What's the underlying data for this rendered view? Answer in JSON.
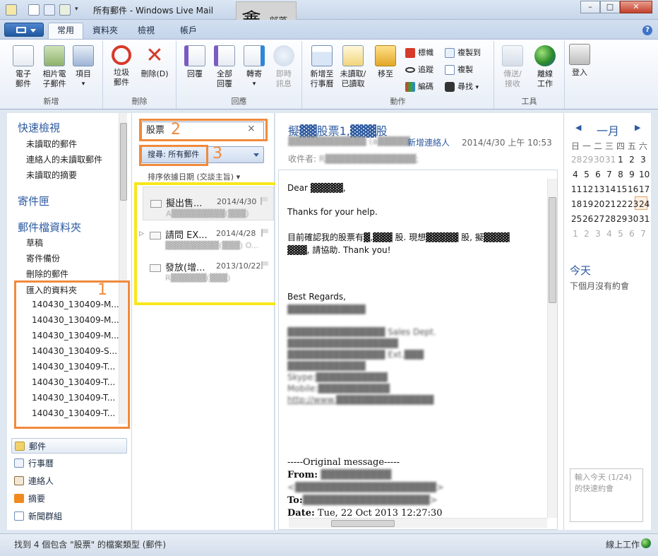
{
  "window": {
    "title": "所有郵件 - Windows Live Mail",
    "logo_main": "鑫",
    "logo_sub": "部落",
    "controls": [
      "–",
      "□",
      "✕"
    ]
  },
  "tabs": [
    "常用",
    "資料夾",
    "檢視",
    "帳戶"
  ],
  "ribbon": {
    "groups": {
      "new": "新增",
      "delete": "刪除",
      "respond": "回應",
      "actions": "動作",
      "tools": "工具"
    },
    "buttons": {
      "email_msg": "電子\n郵件",
      "photo_email": "相片電\n子郵件",
      "items": "項目",
      "junk": "垃圾\n郵件",
      "delete": "刪除(D)",
      "reply": "回覆",
      "reply_all": "全部\n回覆",
      "forward": "轉寄",
      "instant_msg": "即時\n訊息",
      "add_to_calendar": "新增至\n行事曆",
      "unread_read": "未讀取/\n已讀取",
      "move_to": "移至",
      "flag": "標幟",
      "watch": "追蹤",
      "encoding": "編碼",
      "copy_to": "複製到",
      "copy": "複製",
      "find": "尋找",
      "send_receive": "傳送/\n接收",
      "work_offline": "離線\n工作",
      "sign_in": "登入"
    }
  },
  "nav": {
    "quick_views": "快速檢視",
    "quick_items": [
      "未讀取的郵件",
      "連絡人的未讀取郵件",
      "未讀取的摘要"
    ],
    "outbox": "寄件匣",
    "storage": "郵件檔資料夾",
    "storage_items": [
      "草稿",
      "寄件備份",
      "刪除的郵件",
      "匯入的資料夾"
    ],
    "imported": [
      "140430_130409-M...",
      "140430_130409-M...",
      "140430_130409-M...",
      "140430_130409-S...",
      "140430_130409-T...",
      "140430_130409-T...",
      "140430_130409-T...",
      "140430_130409-T..."
    ],
    "sections": [
      "郵件",
      "行事曆",
      "連絡人",
      "摘要",
      "新聞群組"
    ]
  },
  "annotations": [
    "1",
    "2",
    "3"
  ],
  "search": {
    "value": "股票",
    "clear": "×",
    "scope": "搜尋: 所有郵件",
    "sort": "排序依據日期 (交談主旨) ▾"
  },
  "messages": [
    {
      "subject": "擬出售...",
      "date": "2014/4/30",
      "from": "A▓▓▓▓▓▓▓▓▓(▓▓▓)"
    },
    {
      "subject": "請問 EX...",
      "date": "2014/4/28",
      "from": "▓▓▓▓▓▓▓▓▓(▓▓▓) O..."
    },
    {
      "subject": "發放(增...",
      "date": "2013/10/22",
      "from": "R▓▓▓▓▓▓(▓▓▓)"
    }
  ],
  "reading": {
    "subject": "擬▓▓股票1,▓▓▓股",
    "from_blur": "▓▓▓▓▓▓▓▓▓▓▓▓ (a▓▓▓▓▓",
    "add_contact": "新增連絡人",
    "date": "2014/4/30 上午 10:53",
    "to_label": "收件者:",
    "to_blur": "R▓▓▓▓▓▓▓▓▓▓▓▓▓▓;",
    "body": {
      "greeting": "Dear ▓▓▓▓▓,",
      "thanks": "Thanks for your help.",
      "line1": "目前確認我的股票有▓,▓▓▓ 股. 現想▓▓▓▓▓ 股, 擬▓▓▓▓",
      "line2": "▓▓▓, 請協助. Thank you!",
      "regards": "Best Regards,",
      "sig_name": "▓▓▓▓▓▓▓▓▓▓▓▓",
      "sig1": "▓▓▓▓▓▓▓▓▓▓▓▓▓▓▓ Sales Dept.",
      "sig2": "▓▓▓▓▓▓▓▓▓▓▓▓▓▓▓▓▓",
      "sig3": "▓▓▓▓▓▓▓▓▓▓▓▓▓▓▓ Ext.▓▓▓",
      "sig4": "▓▓▓▓▓▓▓▓▓▓▓▓",
      "sig5": "Skype:▓▓▓▓▓▓▓▓▓▓▓",
      "sig6": "Mobile:▓▓▓▓▓▓▓▓▓▓▓",
      "sig7": "http://www.▓▓▓▓▓▓▓▓▓▓▓▓▓▓▓",
      "orig": "-----Original message-----",
      "from_label": "From:",
      "from_val": "▓▓▓▓▓▓▓▓▓▓",
      "from_addr": "<▓▓▓▓▓▓▓▓▓▓▓▓▓▓▓▓▓▓▓▓>",
      "to_label": "To:",
      "to_val": "▓▓▓▓▓▓▓▓▓▓▓▓▓▓▓▓▓▓>",
      "date_label": "Date:",
      "date_val": "Tue, 22 Oct 2013 12:27:30"
    }
  },
  "calendar": {
    "month": "一月",
    "prev": "◀",
    "next": "▶",
    "weekdays": [
      "日",
      "一",
      "二",
      "三",
      "四",
      "五",
      "六"
    ],
    "weeks": [
      [
        "28",
        "29",
        "30",
        "31",
        "1",
        "2",
        "3"
      ],
      [
        "4",
        "5",
        "6",
        "7",
        "8",
        "9",
        "10"
      ],
      [
        "11",
        "12",
        "13",
        "14",
        "15",
        "16",
        "17"
      ],
      [
        "18",
        "19",
        "20",
        "21",
        "22",
        "23",
        "24"
      ],
      [
        "25",
        "26",
        "27",
        "28",
        "29",
        "30",
        "31"
      ],
      [
        "1",
        "2",
        "3",
        "4",
        "5",
        "6",
        "7"
      ]
    ],
    "today_label": "今天",
    "no_appointments": "下個月沒有約會",
    "quick_add_placeholder": "輸入今天 (1/24)\n的快速約會"
  },
  "status": {
    "text": "找到 4 個包含 \"股票\" 的檔案類型 (郵件)",
    "online": "線上工作"
  },
  "colors": {
    "accent": "#2d5aa0",
    "annotation_orange": "#f08a3c",
    "annotation_yellow": "#f8e71c"
  }
}
